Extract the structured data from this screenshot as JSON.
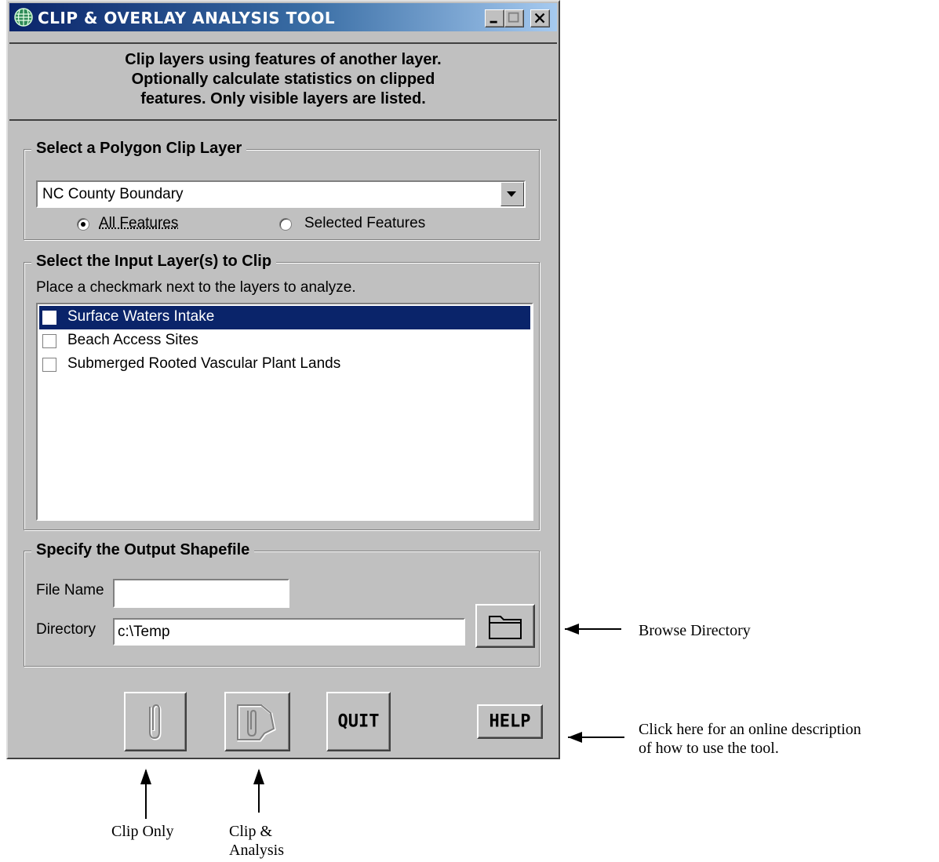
{
  "window": {
    "title": "CLIP & OVERLAY ANALYSIS TOOL",
    "intro": [
      "Clip layers using features of another layer.",
      "Optionally calculate statistics on clipped",
      "features.  Only visible layers are listed."
    ]
  },
  "clip_layer": {
    "legend": "Select a Polygon Clip Layer",
    "selected": "NC County Boundary",
    "options": [
      {
        "label": "All Features",
        "checked": true
      },
      {
        "label": "Selected Features",
        "checked": false
      }
    ]
  },
  "input_layers": {
    "legend": "Select the Input Layer(s) to Clip",
    "hint": "Place a checkmark next to the layers to analyze.",
    "items": [
      {
        "label": "Surface Waters Intake",
        "checked": false,
        "selected": true
      },
      {
        "label": "Beach Access Sites",
        "checked": false,
        "selected": false
      },
      {
        "label": "Submerged Rooted Vascular Plant Lands",
        "checked": false,
        "selected": false
      }
    ]
  },
  "output": {
    "legend": "Specify the Output Shapefile",
    "file_name_label": "File Name",
    "file_name_value": "",
    "directory_label": "Directory",
    "directory_value": "c:\\Temp"
  },
  "buttons": {
    "quit": "QUIT",
    "help": "HELP"
  },
  "annotations": {
    "browse": "Browse Directory",
    "help_line1": "Click here for an online description",
    "help_line2": "of how to use the tool.",
    "clip_only": "Clip Only",
    "clip_analysis_line1": "Clip &",
    "clip_analysis_line2": "Analysis"
  }
}
